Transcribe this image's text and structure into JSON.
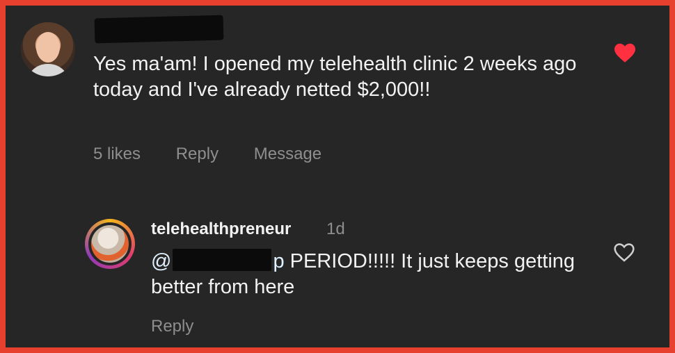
{
  "comment": {
    "text": "Yes ma'am! I opened my telehealth clinic 2 weeks ago today and I've already netted $2,000!!",
    "likes": "5 likes",
    "reply_label": "Reply",
    "message_label": "Message",
    "like_state": "liked",
    "heart_color": "#ff3040"
  },
  "reply": {
    "username": "telehealthpreneur",
    "time": "1d",
    "mention_prefix": "@",
    "mention_suffix": "p",
    "text": " PERIOD!!!!! It just keeps getting better from here",
    "reply_label": "Reply",
    "like_state": "not-liked"
  },
  "colors": {
    "background": "#262626",
    "border": "#e8402f",
    "primary_text": "#f2f2f2",
    "secondary_text": "#8e8e8e"
  }
}
